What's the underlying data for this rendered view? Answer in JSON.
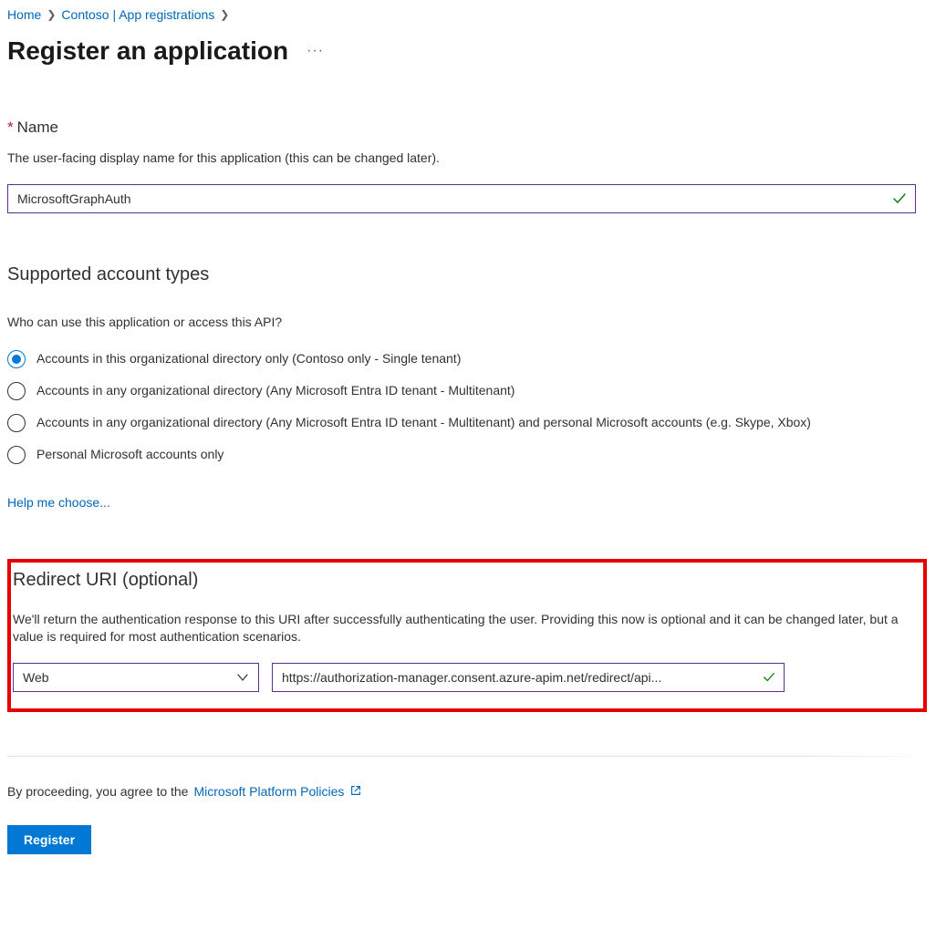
{
  "breadcrumb": {
    "home": "Home",
    "tenant": "Contoso | App registrations"
  },
  "page": {
    "title": "Register an application"
  },
  "name_section": {
    "label": "Name",
    "desc": "The user-facing display name for this application (this can be changed later).",
    "value": "MicrosoftGraphAuth"
  },
  "accounts_section": {
    "heading": "Supported account types",
    "question": "Who can use this application or access this API?",
    "options": [
      "Accounts in this organizational directory only (Contoso only - Single tenant)",
      "Accounts in any organizational directory (Any Microsoft Entra ID tenant - Multitenant)",
      "Accounts in any organizational directory (Any Microsoft Entra ID tenant - Multitenant) and personal Microsoft accounts (e.g. Skype, Xbox)",
      "Personal Microsoft accounts only"
    ],
    "help_link": "Help me choose..."
  },
  "redirect_section": {
    "heading": "Redirect URI (optional)",
    "desc": "We'll return the authentication response to this URI after successfully authenticating the user. Providing this now is optional and it can be changed later, but a value is required for most authentication scenarios.",
    "platform": "Web",
    "uri_display": "https://authorization-manager.consent.azure-apim.net/redirect/api..."
  },
  "consent": {
    "prefix": "By proceeding, you agree to the ",
    "link": "Microsoft Platform Policies"
  },
  "buttons": {
    "register": "Register"
  }
}
